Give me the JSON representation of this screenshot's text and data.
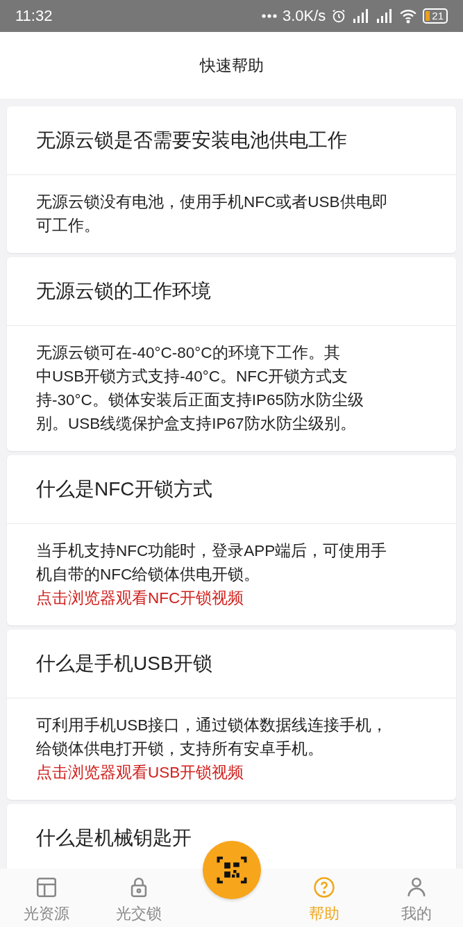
{
  "status_bar": {
    "time": "11:32",
    "speed": "3.0K/s",
    "battery": "21"
  },
  "header": {
    "title": "快速帮助"
  },
  "faq": [
    {
      "question": "无源云锁是否需要安装电池供电工作",
      "answer": [
        "无源云锁没有电池，使用手机NFC或者USB供电即",
        "可工作。"
      ]
    },
    {
      "question": "无源云锁的工作环境",
      "answer": [
        "无源云锁可在-40°C-80°C的环境下工作。其",
        "中USB开锁方式支持-40°C。NFC开锁方式支",
        "持-30°C。锁体安装后正面支持IP65防水防尘级",
        "别。USB线缆保护盒支持IP67防水防尘级别。"
      ]
    },
    {
      "question": "什么是NFC开锁方式",
      "answer": [
        "当手机支持NFC功能时，登录APP端后，可使用手",
        "机自带的NFC给锁体供电开锁。"
      ],
      "link": "点击浏览器观看NFC开锁视频"
    },
    {
      "question": "什么是手机USB开锁",
      "answer": [
        "可利用手机USB接口，通过锁体数据线连接手机，",
        "给锁体供电打开锁，支持所有安卓手机。"
      ],
      "link": "点击浏览器观看USB开锁视频"
    },
    {
      "question": "什么是机械钥匙开"
    }
  ],
  "tab_bar": [
    {
      "kind": "tab",
      "label": "光资源",
      "selected": false
    },
    {
      "kind": "tab",
      "label": "光交锁",
      "selected": false
    },
    {
      "kind": "scan"
    },
    {
      "kind": "tab",
      "label": "帮助",
      "selected": true
    },
    {
      "kind": "tab",
      "label": "我的",
      "selected": false
    }
  ]
}
